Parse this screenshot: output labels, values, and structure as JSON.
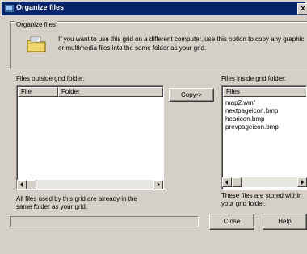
{
  "window": {
    "title": "Organize files",
    "close_glyph": "x"
  },
  "group": {
    "label": "Organize files",
    "icon": "folder-icon",
    "description": "If you want to use this grid on a different computer, use this option to copy any graphic or multimedia files into the same folder as your grid."
  },
  "outside": {
    "label": "Files outside grid folder:",
    "columns": [
      "File",
      "Folder"
    ],
    "rows": [],
    "note": "All files used by this grid are already in the same folder as your grid."
  },
  "copy_button": "Copy->",
  "inside": {
    "label": "Files inside grid folder:",
    "column": "Files",
    "files": [
      "map2.wmf",
      "nextpageicon.bmp",
      "hearicon.bmp",
      "prevpageicon.bmp"
    ],
    "note": "These files are stored within your grid folder."
  },
  "footer": {
    "close_label": "Close",
    "help_label": "Help"
  },
  "colors": {
    "titlebar": "#0a246a",
    "face": "#d4d0c8"
  }
}
